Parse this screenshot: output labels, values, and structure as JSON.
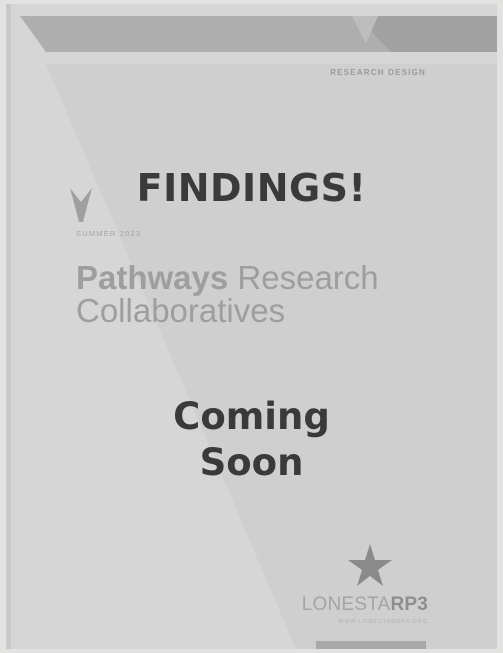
{
  "cover": {
    "section_label": "RESEARCH DESIGN",
    "announcement": "FINDINGS!",
    "season": "SUMMER 2023",
    "title_bold": "Pathways",
    "title_rest": " Research",
    "title_line2": "Collaboratives",
    "coming_line1": "Coming",
    "coming_line2": "Soon",
    "logo_light": "LONESTA",
    "logo_bold": "RP3",
    "logo_url": "WWW.LONESTARRP3.ORG"
  },
  "colors": {
    "background": "#d5d5d5",
    "banner": "#aeaeae",
    "heading_text": "#3a3a3a",
    "faded_text": "#9e9e9e"
  },
  "icons": [
    "chevron-down-icon",
    "star-icon"
  ]
}
